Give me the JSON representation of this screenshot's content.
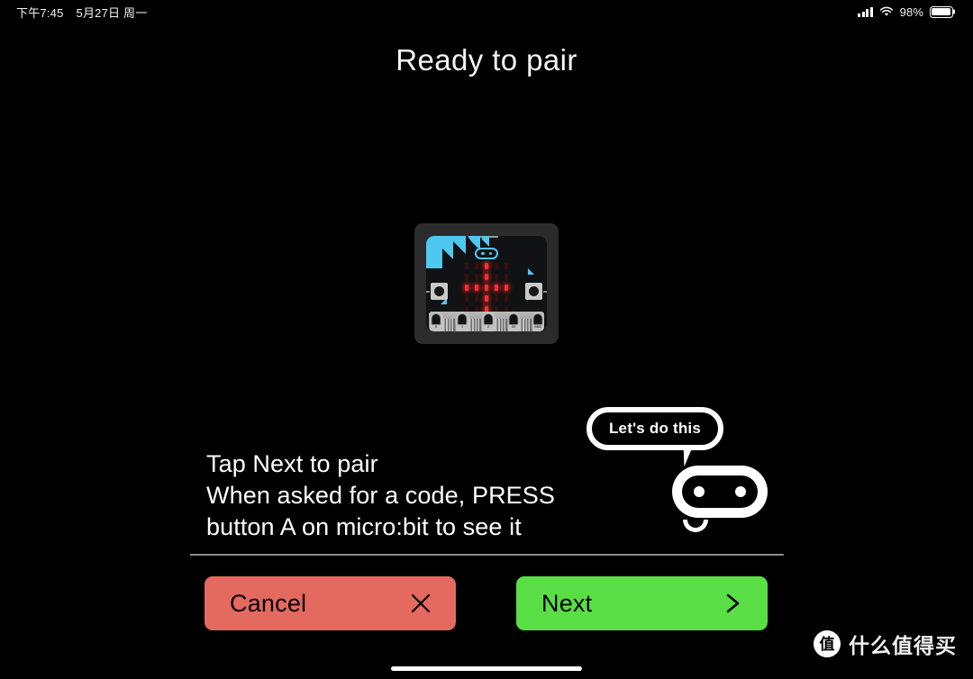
{
  "status_bar": {
    "time": "下午7:45",
    "date": "5月27日 周一",
    "signal_icon": "cellular-signal-icon",
    "wifi_icon": "wifi-icon",
    "battery_percent": "98%",
    "battery_icon": "battery-icon"
  },
  "header": {
    "title": "Ready to pair"
  },
  "illustration": {
    "device_name": "micro:bit board",
    "board_logo_icon": "microbit-robot-logo-icon",
    "button_a_label": "A",
    "button_b_label": "B",
    "edge_pads": [
      "0",
      "1",
      "2",
      "3V",
      "GND"
    ],
    "led_matrix": [
      [
        0,
        0,
        1,
        0,
        0
      ],
      [
        0,
        0,
        1,
        0,
        0
      ],
      [
        1,
        1,
        1,
        1,
        1
      ],
      [
        0,
        0,
        1,
        0,
        0
      ],
      [
        0,
        0,
        1,
        0,
        0
      ]
    ],
    "led_on_color": "#f03030",
    "accent_color": "#4ec8ef"
  },
  "instructions": {
    "line1": "Tap Next to pair",
    "line2": "When asked for a code, PRESS",
    "line3": "button A on micro:bit to see it",
    "full_text": "Tap Next to pair\nWhen asked for a code, PRESS\nbutton A on micro:bit to see it"
  },
  "mascot": {
    "bubble_text": "Let's do this",
    "robot_icon": "robot-face-icon"
  },
  "actions": {
    "cancel": {
      "label": "Cancel",
      "icon": "close-x-icon",
      "color": "#e4695e"
    },
    "next": {
      "label": "Next",
      "icon": "chevron-right-icon",
      "color": "#5ade45"
    }
  },
  "watermark": {
    "logo_char": "值",
    "text": "什么值得买"
  },
  "theme": {
    "background": "#000000",
    "text": "#ffffff",
    "divider": "#8c8c8c"
  }
}
